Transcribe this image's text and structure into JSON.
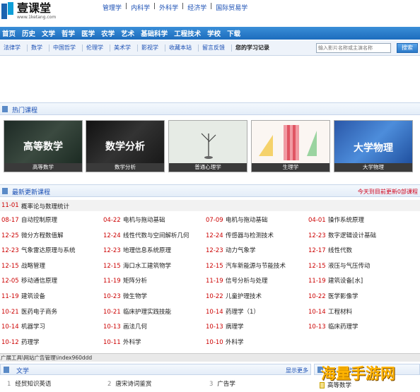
{
  "header": {
    "logo_title": "壹课堂",
    "logo_url": "www.1ketang.com",
    "top_links": [
      "管理学",
      "内科学",
      "外科学",
      "经济学",
      "国际贸易学"
    ]
  },
  "mainnav": [
    "首页",
    "历史",
    "文学",
    "哲学",
    "医学",
    "农学",
    "艺术",
    "基础科学",
    "工程技术",
    "学校",
    "下载"
  ],
  "subnav": {
    "items": [
      "法律学",
      "数学",
      "中国哲学",
      "伦理学",
      "美术学",
      "影视学",
      "收藏本站",
      "留言反馈"
    ],
    "my_log": "您的学习记录",
    "search_placeholder": "输入影片名称或主演名称",
    "search_button": "搜索"
  },
  "hot": {
    "title": "热门课程",
    "courses": [
      {
        "caption": "高等数学",
        "overlay": "高等数学"
      },
      {
        "caption": "数学分析",
        "overlay": "数学分析"
      },
      {
        "caption": "普通心理学",
        "overlay": ""
      },
      {
        "caption": "生理学",
        "overlay": ""
      },
      {
        "caption": "大学物理",
        "overlay": "大学物理"
      }
    ]
  },
  "latest": {
    "title": "最新更新课程",
    "note": "今天到目前更新0部课程",
    "highlight": {
      "date": "11-01",
      "name": "概率论与数理统计"
    },
    "rows": [
      [
        [
          "08-17",
          "自动控制原理"
        ],
        [
          "04-22",
          "电机与拖动基础"
        ],
        [
          "07-09",
          "电机与拖动基础"
        ],
        [
          "04-01",
          "操作系统原理"
        ]
      ],
      [
        [
          "12-25",
          "微分方程数值解"
        ],
        [
          "12-24",
          "线性代数与空间解析几何"
        ],
        [
          "12-24",
          "传感器与检测技术"
        ],
        [
          "12-23",
          "数字逻辑设计基础"
        ]
      ],
      [
        [
          "12-23",
          "气象雷达原理与系统"
        ],
        [
          "12-23",
          "地理信息系统原理"
        ],
        [
          "12-23",
          "动力气象学"
        ],
        [
          "12-17",
          "线性代数"
        ]
      ],
      [
        [
          "12-15",
          "战略管理"
        ],
        [
          "12-15",
          "海口水工建筑物学"
        ],
        [
          "12-15",
          "汽车新能源与节能技术"
        ],
        [
          "12-15",
          "液压与气压传动"
        ]
      ],
      [
        [
          "12-05",
          "移动通信原理"
        ],
        [
          "11-19",
          "矩阵分析"
        ],
        [
          "11-19",
          "信号分析与处理"
        ],
        [
          "11-19",
          "建筑设备[水]"
        ]
      ],
      [
        [
          "11-19",
          "建筑设备"
        ],
        [
          "10-23",
          "微生物学"
        ],
        [
          "10-22",
          "儿童护理技术"
        ],
        [
          "10-22",
          "医学影像学"
        ]
      ],
      [
        [
          "10-21",
          "医药电子商务"
        ],
        [
          "10-21",
          "临床护理实践技能"
        ],
        [
          "10-14",
          "药理学（1）"
        ],
        [
          "10-14",
          "工程材料"
        ]
      ],
      [
        [
          "10-14",
          "机器学习"
        ],
        [
          "10-13",
          "画法几何"
        ],
        [
          "10-13",
          "病理学"
        ],
        [
          "10-13",
          "临床药理学"
        ]
      ],
      [
        [
          "10-12",
          "药理学"
        ],
        [
          "10-11",
          "外科学"
        ],
        [
          "10-10",
          "外科学"
        ],
        [
          "",
          ""
        ]
      ]
    ]
  },
  "statusbar": "广展工具\\网站广告管理\\index960ddd",
  "bottom": {
    "left_title": "文学",
    "more": "显示更多",
    "items": [
      {
        "num": "1",
        "text": "经贸知识英语"
      },
      {
        "num": "2",
        "text": "唐宋诗词鉴赏"
      },
      {
        "num": "3",
        "text": "广告学"
      }
    ],
    "right_title": "基础科学",
    "right_item": "高等数学"
  },
  "watermark": "海量手游网"
}
